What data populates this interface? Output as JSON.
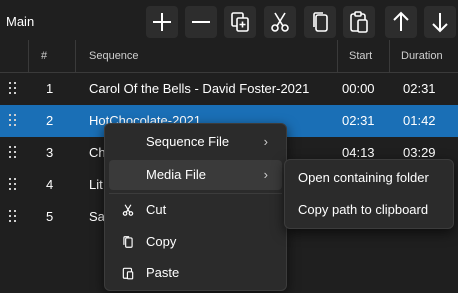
{
  "toolbar": {
    "title": "Main",
    "buttons": [
      {
        "name": "add",
        "icon": "plus-icon"
      },
      {
        "name": "remove",
        "icon": "minus-icon"
      },
      {
        "name": "duplicate",
        "icon": "duplicate-icon"
      },
      {
        "name": "cut",
        "icon": "scissors-icon"
      },
      {
        "name": "copy",
        "icon": "copy-icon"
      },
      {
        "name": "paste",
        "icon": "paste-icon"
      },
      {
        "name": "move-up",
        "icon": "arrow-up-icon"
      },
      {
        "name": "move-down",
        "icon": "arrow-down-icon"
      }
    ]
  },
  "table": {
    "columns": {
      "num": "#",
      "sequence": "Sequence",
      "start": "Start",
      "duration": "Duration"
    },
    "rows": [
      {
        "num": "1",
        "sequence": "Carol Of the Bells - David Foster-2021",
        "start": "00:00",
        "duration": "02:31"
      },
      {
        "num": "2",
        "sequence": "HotChocolate-2021",
        "start": "02:31",
        "duration": "01:42"
      },
      {
        "num": "3",
        "sequence": "Ch",
        "start": "04:13",
        "duration": "03:29"
      },
      {
        "num": "4",
        "sequence": "Lit",
        "start": "",
        "duration": ""
      },
      {
        "num": "5",
        "sequence": "Sa",
        "start": "",
        "duration": ""
      }
    ],
    "selected_row": 2
  },
  "context_menu": {
    "items": [
      {
        "label": "Sequence File"
      },
      {
        "label": "Media File"
      },
      {
        "label": "Cut",
        "icon": "scissors-icon"
      },
      {
        "label": "Copy",
        "icon": "copy-icon"
      },
      {
        "label": "Paste",
        "icon": "paste-icon"
      }
    ]
  },
  "submenu": {
    "items": [
      {
        "label": "Open containing folder"
      },
      {
        "label": "Copy path to clipboard"
      }
    ]
  },
  "colors": {
    "selection": "#1a6fb6",
    "background": "#1f1f1f",
    "menu": "#2b2b2b"
  }
}
